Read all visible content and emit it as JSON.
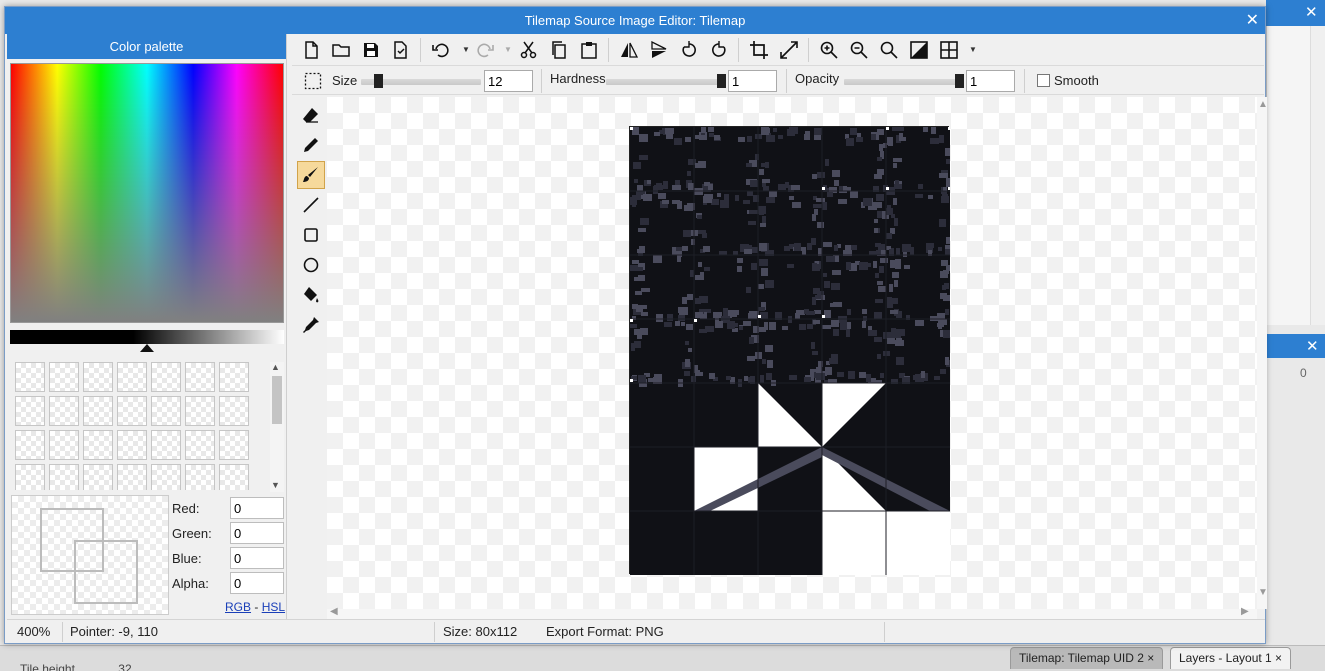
{
  "window": {
    "title": "Tilemap Source Image Editor: Tilemap",
    "close_glyph": "✕"
  },
  "palette": {
    "header": "Color palette",
    "red_label": "Red:",
    "green_label": "Green:",
    "blue_label": "Blue:",
    "alpha_label": "Alpha:",
    "red": "0",
    "green": "0",
    "blue": "0",
    "alpha": "0",
    "mode_rgb": "RGB",
    "mode_sep": " - ",
    "mode_hsl": "HSL",
    "luminance_marker_fraction": 0.5
  },
  "toolbar": {
    "icons": [
      "new-file-icon",
      "open-folder-icon",
      "save-icon",
      "save-as-icon",
      "undo-icon",
      "redo-icon",
      "cut-icon",
      "copy-icon",
      "paste-icon",
      "flip-horizontal-icon",
      "flip-vertical-icon",
      "rotate-left-icon",
      "rotate-right-icon",
      "crop-icon",
      "resize-icon",
      "zoom-in-icon",
      "zoom-out-icon",
      "zoom-reset-icon",
      "invert-icon",
      "grid-icon"
    ]
  },
  "options": {
    "size_label": "Size",
    "size_value": "12",
    "size_fraction": 0.12,
    "hardness_label": "Hardness",
    "hardness_value": "1",
    "hardness_fraction": 1.0,
    "opacity_label": "Opacity",
    "opacity_value": "1",
    "opacity_fraction": 1.0,
    "smooth_label": "Smooth",
    "smooth_checked": false
  },
  "tools": {
    "items": [
      "eraser-icon",
      "pencil-icon",
      "brush-icon",
      "line-icon",
      "rectangle-icon",
      "ellipse-icon",
      "fill-bucket-icon",
      "eyedropper-icon"
    ],
    "active": "brush-icon"
  },
  "status": {
    "zoom": "400%",
    "pointer": "Pointer: -9, 110",
    "size": "Size: 80x112",
    "format": "Export Format: PNG"
  },
  "background": {
    "tab_active": "Tilemap: Tilemap UID 2",
    "tab_inactive": "Layers - Layout 1",
    "panel_value": "0",
    "tile_height_label": "Tile height",
    "tile_height_value": "32"
  },
  "colors": {
    "accent": "#2d7fd1",
    "tile_dark": "#101116",
    "tile_mid": "#2c2d3a",
    "tile_light": "#4a4b5c"
  }
}
